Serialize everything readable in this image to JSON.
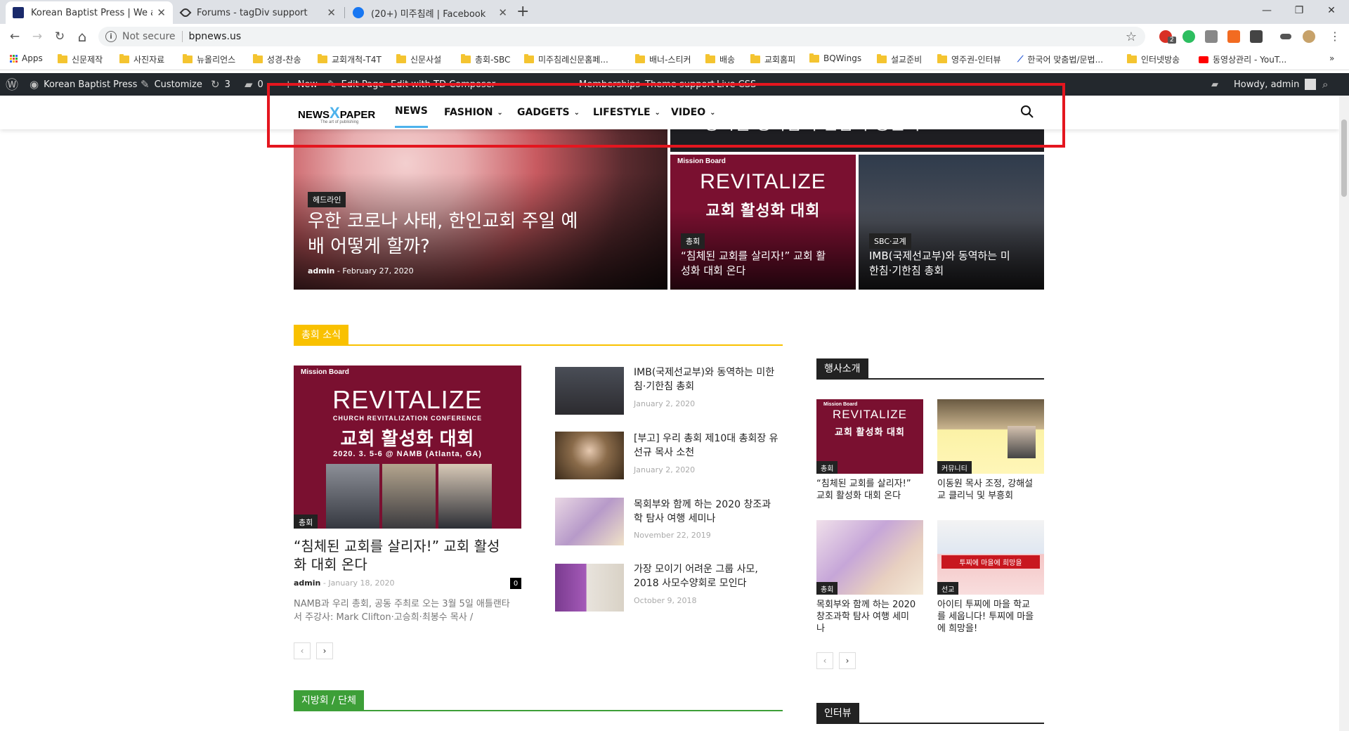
{
  "browser": {
    "tabs": [
      {
        "title": "Korean Baptist Press | We are u",
        "active": true
      },
      {
        "title": "Forums - tagDiv support",
        "active": false
      },
      {
        "title": "(20+) 미주침례 | Facebook",
        "active": false
      }
    ],
    "new_tab_symbol": "+",
    "close_symbol": "✕",
    "window_controls": {
      "minimize": "—",
      "maximize": "❐",
      "close": "✕"
    },
    "nav": {
      "back": "←",
      "forward": "→",
      "reload": "↻",
      "home": "⌂"
    },
    "address": {
      "security": "Not secure",
      "url": "bpnews.us"
    },
    "extension_badge": "2",
    "bookmarks": [
      "Apps",
      "신문제작",
      "사진자료",
      "뉴올리언스",
      "성경-찬송",
      "교회개척-T4T",
      "신문사설",
      "총회-SBC",
      "미주침례신문홈페...",
      "배너-스티커",
      "배송",
      "교회홈피",
      "BQWings",
      "설교준비",
      "영주권-인터뷰",
      "한국어 맞춤법/문법...",
      "인터넷방송",
      "동영상관리 - YouT..."
    ],
    "bookmarks_more": "»"
  },
  "wpbar": {
    "site": "Korean Baptist Press",
    "customize": "Customize",
    "updates": "3",
    "comments": "0",
    "new": "New",
    "edit_page": "Edit Page",
    "edit_with": "Edit with TD Composer",
    "memberships": "Memberships",
    "theme_support": "Theme support",
    "live_css": "Live CSS",
    "howdy": "Howdy, admin"
  },
  "site_menu": {
    "logo_main": "NEWS",
    "logo_x": "X",
    "logo_paper": "PAPER",
    "logo_tag": "The art of publishing",
    "items": [
      "NEWS",
      "FASHION",
      "GADGETS",
      "LIFESTYLE",
      "VIDEO"
    ],
    "active_index": 0
  },
  "hero": {
    "main": {
      "category": "헤드라인",
      "title_line1": "우한 코로나 사태, 한인교회 주일 예",
      "title_line2": "배 어떻게 할까?",
      "author": "admin",
      "sep": "-",
      "date": "February 27, 2020"
    },
    "top_right_title": "\"성시절 생각납니 반갑다 동문아\"",
    "card2": {
      "category": "총회",
      "title_line1": "“침체된 교회를 살리자!” 교회 활",
      "title_line2": "성화 대회 온다"
    },
    "card3": {
      "category": "SBC·교계",
      "title_line1": "IMB(국제선교부)와 동역하는 미",
      "title_line2": "한침·기한침 총회"
    }
  },
  "revitalize": {
    "brand": "Mission Board",
    "word": "REVITALIZE",
    "sub": "CHURCH REVITALIZATION CONFERENCE",
    "korean": "교회 활성화 대회",
    "date": "2020. 3. 5-6 @ NAMB (Atlanta, GA)"
  },
  "section1": {
    "heading": "총회 소식",
    "feature": {
      "category": "총회",
      "title_line1": "“침체된 교회를 살리자!” 교회 활성",
      "title_line2": "화 대회 온다",
      "author": "admin",
      "sep": "-",
      "date": "January 18, 2020",
      "comments": "0",
      "excerpt_line1": "NAMB과 우리 총회, 공동 주최로 오는 3월 5일 애틀랜타",
      "excerpt_line2": "서 주강사: Mark Clifton·고승희·최봉수 목사 /"
    },
    "list": [
      {
        "t1": "IMB(국제선교부)와 동역하는 미한",
        "t2": "침·기한침 총회",
        "date": "January 2, 2020"
      },
      {
        "t1": "[부고] 우리 총회 제10대 총회장 유",
        "t2": "선규 목사 소천",
        "date": "January 2, 2020"
      },
      {
        "t1": "목회부와 함께 하는 2020 창조과",
        "t2": "학 탐사 여행 세미나",
        "date": "November 22, 2019"
      },
      {
        "t1": "가장 모이기 어려운 그룹 사모,",
        "t2": "2018 사모수양회로 모인다",
        "date": "October 9, 2018"
      }
    ],
    "prev": "‹",
    "next": "›"
  },
  "section2": {
    "heading": "지방회 / 단체"
  },
  "sidebar": {
    "heading": "행사소개",
    "cards": [
      {
        "category": "총회",
        "t1": "“침체된 교회를 살리자!”",
        "t2": "교회 활성화 대회 온다",
        "t3": ""
      },
      {
        "category": "커뮤니티",
        "t1": "이동원 목사 조정, 강해설",
        "t2": "교 클리닉 및 부흥회",
        "t3": ""
      },
      {
        "category": "총회",
        "t1": "목회부와 함께 하는 2020",
        "t2": "창조과학 탐사 여행 세미",
        "t3": "나"
      },
      {
        "category": "선교",
        "t1": "아이티 투찌에 마을 학교",
        "t2": "를 세웁니다! 투찌에 마을",
        "t3": "에 희망을!"
      }
    ],
    "banner_text": "투찌에 마을에 희망을",
    "heading2": "인터뷰",
    "prev": "‹",
    "next": "›"
  },
  "colors": {
    "accent_blue": "#4db2ec",
    "section_yellow": "#f9c100",
    "section_green": "#3d9f38",
    "highlight_red": "#e4161f",
    "revitalize_bg": "#7a1030"
  }
}
